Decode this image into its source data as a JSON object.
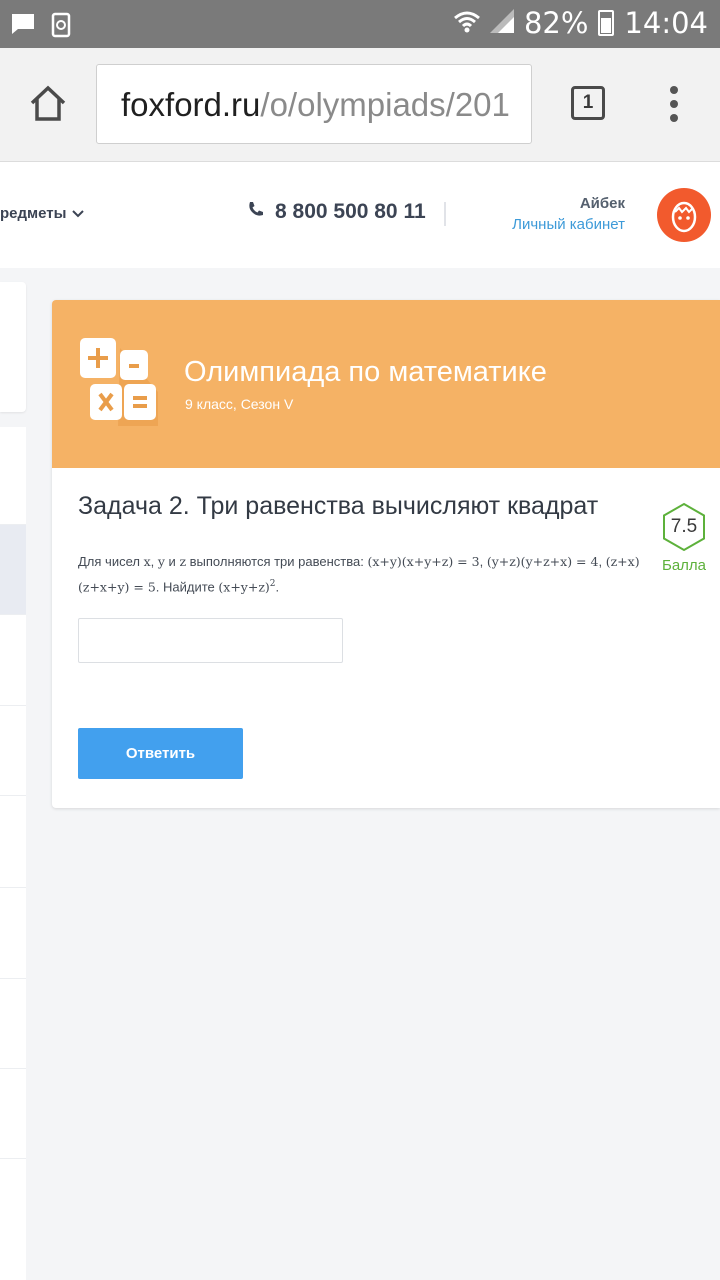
{
  "status_bar": {
    "battery": "82%",
    "time": "14:04",
    "icons": [
      "message-icon",
      "recycle-icon",
      "wifi-icon",
      "signal-icon",
      "battery-icon"
    ]
  },
  "browser": {
    "url_host": "foxford.ru",
    "url_path": "/o/olympiads/201",
    "tab_count": "1",
    "icons": [
      "home-icon",
      "tabs-icon",
      "overflow-menu-icon"
    ]
  },
  "header": {
    "subjects_label": "редметы",
    "phone": "8 800 500 80 11",
    "user_name": "Айбек",
    "cabinet_link": "Личный кабинет",
    "avatar_color": "#f25a2d"
  },
  "olympiad": {
    "title": "Олимпиада по математике",
    "subtitle": "9 класс, Сезон V",
    "header_color": "#f5b265"
  },
  "task": {
    "title": "Задача 2. Три равенства вычисляют квадрат",
    "score_value": "7.5",
    "score_label": "Балла",
    "score_color": "#5db13b",
    "text_intro": "Для чисел ",
    "var_x": "x",
    "sep1": ", ",
    "var_y": "y",
    "and": " и ",
    "var_z": "z",
    "text_mid": " выполняются три равенства: ",
    "eq1": "(x+y)(x+y+z) = 3",
    "sep2": ", ",
    "eq2": "(y+z)(y+z+x) = 4",
    "sep3": ", ",
    "eq3": "(z+x)(z+x+y) = 5",
    "text_find": ". Найдите ",
    "target": "(x+y+z)",
    "target_exp": "2",
    "text_end": ".",
    "answer_value": "",
    "submit_label": "Ответить",
    "accent_color": "#42a0ee"
  }
}
